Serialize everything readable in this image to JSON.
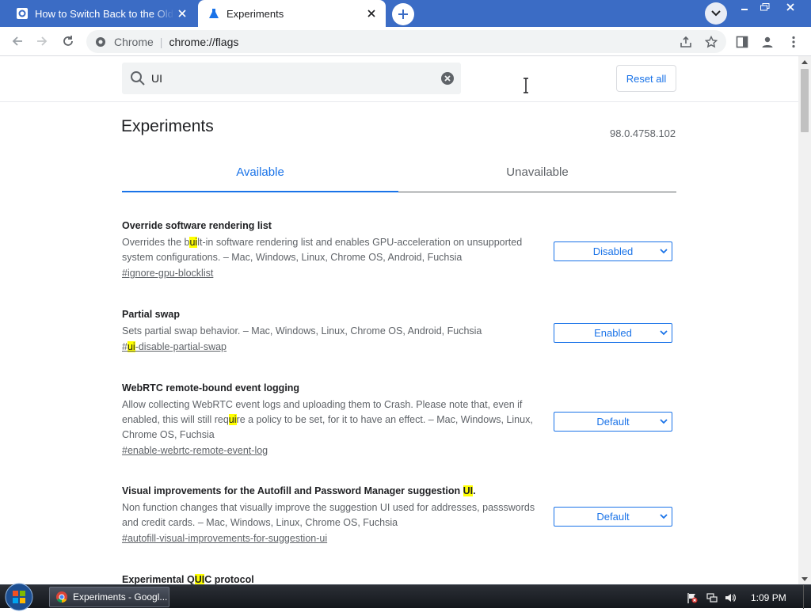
{
  "browser": {
    "tabs": [
      {
        "title": "How to Switch Back to the Old Chrome",
        "active": false
      },
      {
        "title": "Experiments",
        "active": true
      }
    ],
    "omnibox": {
      "site_name": "Chrome",
      "separator": "|",
      "url": "chrome://flags"
    }
  },
  "flags_page": {
    "search": {
      "value": "UI"
    },
    "reset_label": "Reset all",
    "title": "Experiments",
    "version": "98.0.4758.102",
    "tabs": {
      "available": "Available",
      "unavailable": "Unavailable"
    },
    "experiments": [
      {
        "name": "Override software rendering list",
        "desc": {
          "before": "Overrides the b",
          "hl": "ui",
          "after": "lt-in software rendering list and enables GPU-acceleration on unsupported system configurations. – Mac, Windows, Linux, Chrome OS, Android, Fuchsia"
        },
        "link": {
          "before": "#ignore-gpu-blocklist",
          "hl": "",
          "after": ""
        },
        "value": "Disabled"
      },
      {
        "name": "Partial swap",
        "desc": {
          "before": "Sets partial swap behavior. – Mac, Windows, Linux, Chrome OS, Android, Fuchsia",
          "hl": "",
          "after": ""
        },
        "link": {
          "before": "#",
          "hl": "ui",
          "after": "-disable-partial-swap"
        },
        "value": "Enabled"
      },
      {
        "name": "WebRTC remote-bound event logging",
        "desc": {
          "before": "Allow collecting WebRTC event logs and uploading them to Crash. Please note that, even if enabled, this will still req",
          "hl": "ui",
          "after": "re a policy to be set, for it to have an effect. – Mac, Windows, Linux, Chrome OS, Fuchsia"
        },
        "link": {
          "before": "#enable-webrtc-remote-event-log",
          "hl": "",
          "after": ""
        },
        "value": "Default"
      },
      {
        "name_before": "Visual improvements for the Autofill and Password Manager suggestion ",
        "name_hl": "UI",
        "name_after": ".",
        "desc": {
          "before": "Non function changes that visually improve the suggestion UI used for addresses, passswords and credit cards. – Mac, Windows, Linux, Chrome OS, Fuchsia",
          "hl": "",
          "after": ""
        },
        "link": {
          "before": "#autofill-visual-improvements-for-suggestion-ui",
          "hl": "",
          "after": ""
        },
        "value": "Default"
      },
      {
        "name_before": "Experimental Q",
        "name_hl": "UI",
        "name_after": "C protocol"
      }
    ]
  },
  "taskbar": {
    "task_label": "Experiments - Googl...",
    "clock": "1:09 PM"
  },
  "colors": {
    "accent": "#1a73e8",
    "tabstrip": "#3b6cc5",
    "highlight": "#ffff00"
  }
}
